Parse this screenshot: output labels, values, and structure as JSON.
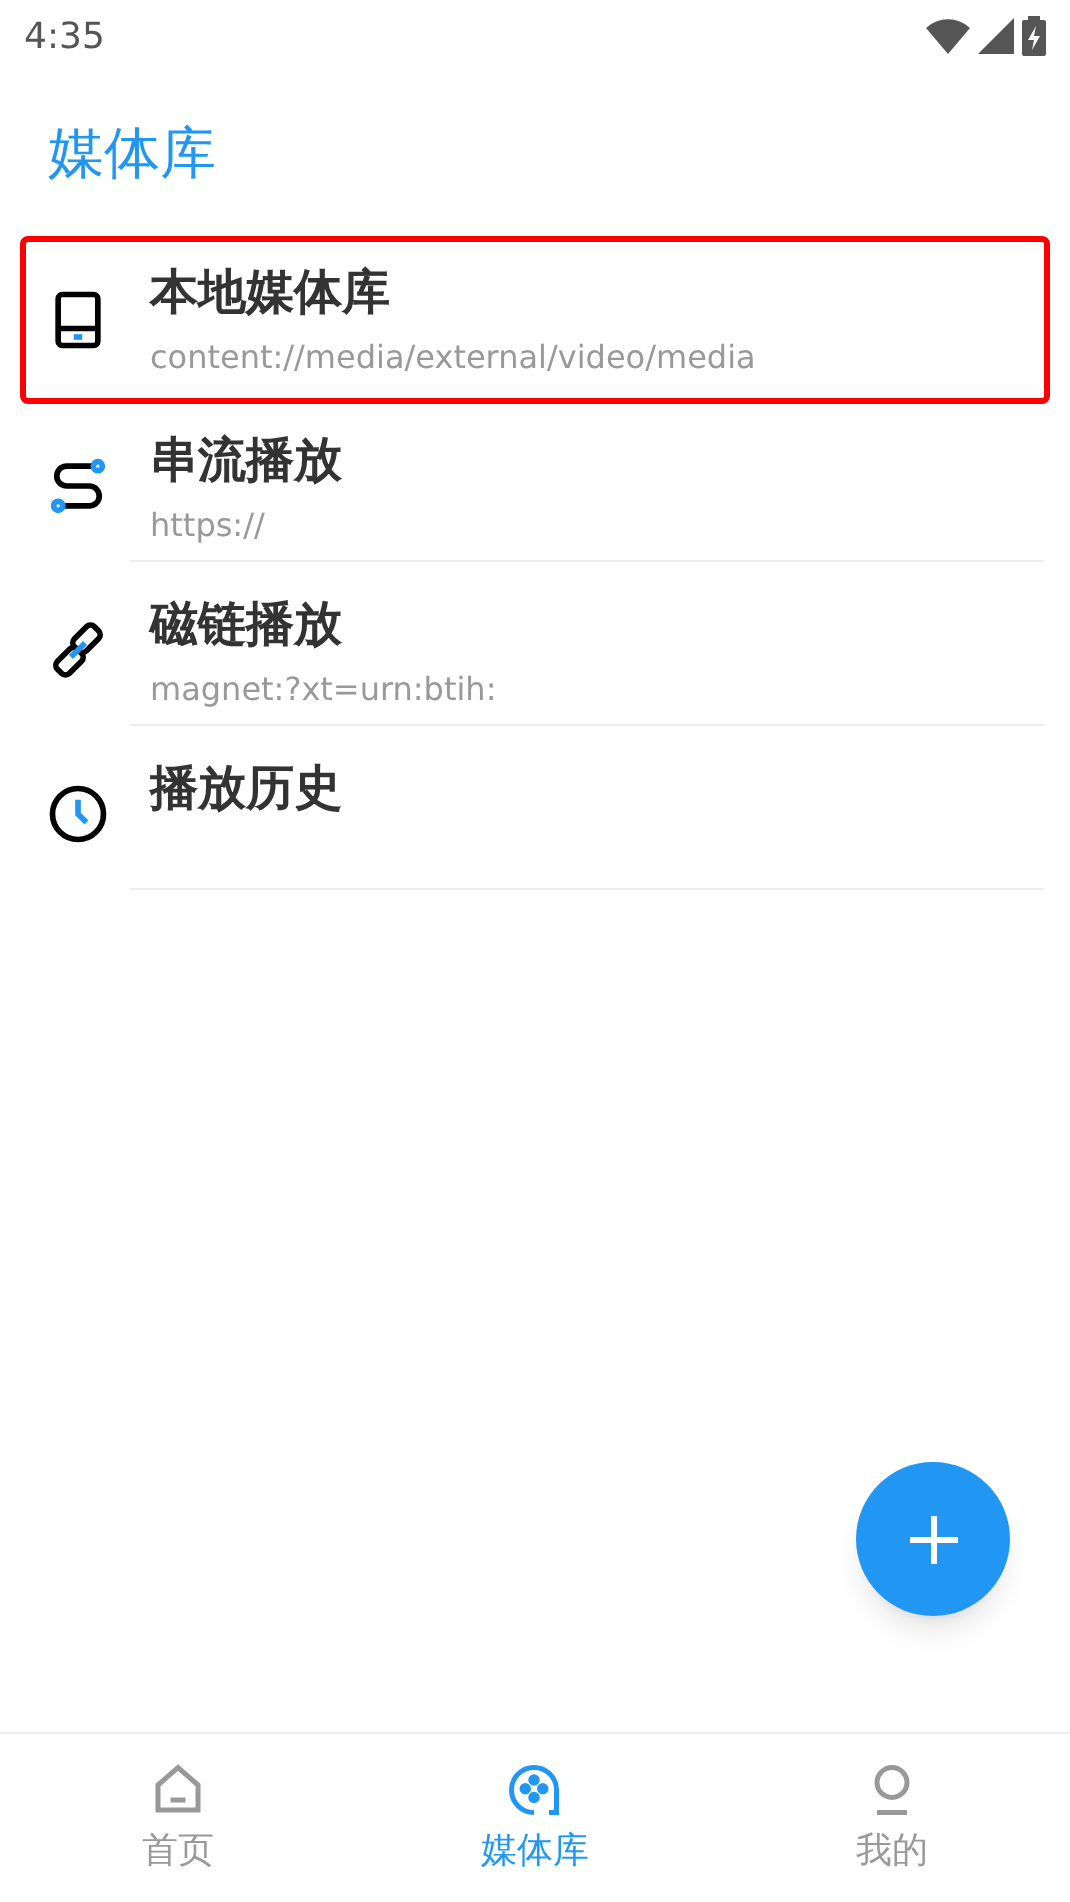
{
  "status_bar": {
    "time": "4:35"
  },
  "title": "媒体库",
  "items": [
    {
      "kind": "local",
      "title": "本地媒体库",
      "subtitle": "content://media/external/video/media",
      "highlighted": true
    },
    {
      "kind": "stream",
      "title": "串流播放",
      "subtitle": "https://",
      "highlighted": false
    },
    {
      "kind": "magnet",
      "title": "磁链播放",
      "subtitle": "magnet:?xt=urn:btih:",
      "highlighted": false
    },
    {
      "kind": "history",
      "title": "播放历史",
      "highlighted": false
    }
  ],
  "nav": [
    {
      "kind": "home",
      "label": "首页",
      "selected": false
    },
    {
      "kind": "library",
      "label": "媒体库",
      "selected": true
    },
    {
      "kind": "me",
      "label": "我的",
      "selected": false
    }
  ]
}
